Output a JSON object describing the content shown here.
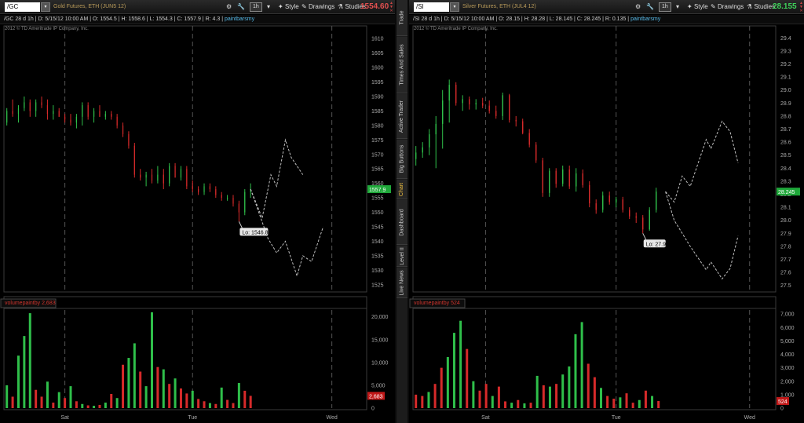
{
  "sidebar": {
    "tabs": [
      "Trade",
      "Times And Sales",
      "Active Trader",
      "Big Buttons",
      "Chart",
      "Dashboard",
      "Level II",
      "Live News"
    ],
    "active": "Chart"
  },
  "toolbar": {
    "aggregation_label": "1h",
    "style_label": "Style",
    "drawings_label": "Drawings",
    "studies_label": "Studies"
  },
  "colors": {
    "up": "#2fbf4a",
    "down": "#d62a2a",
    "grid": "#555555",
    "background": "#000000",
    "volume_study": "#d0342c",
    "study_label": "#56b8e6"
  },
  "left": {
    "symbol": "/GC",
    "description": "Gold Futures, ETH (JUN5 12)",
    "last_price": "1554.60",
    "last_price_color": "#e05050",
    "info_symbol": "/GC 28 d 1h",
    "info_date": "D: 5/15/12 10:00 AM",
    "info_open": "O: 1554.5",
    "info_high": "H: 1558.6",
    "info_low": "L: 1554.3",
    "info_close": "C: 1557.9",
    "info_range": "R: 4.3",
    "study_name": "paintbarsmy",
    "copyright": "2012 © TD Ameritrade IP Company, Inc.",
    "price_label": "1557.9",
    "low_label": "Lo: 1546.8",
    "volume_label": "volumepaintby",
    "volume_value": "2,683",
    "volume_marker": "2,683"
  },
  "right": {
    "symbol": "/SI",
    "description": "Silver Futures, ETH (JUL4 12)",
    "last_price": "28.155",
    "last_price_color": "#3fd05a",
    "info_symbol": "/SI 28 d 1h",
    "info_date": "D: 5/15/12 10:00 AM",
    "info_open": "O: 28.15",
    "info_high": "H: 28.28",
    "info_low": "L: 28.145",
    "info_close": "C: 28.245",
    "info_range": "R: 0.135",
    "study_name": "paintbarsmy",
    "copyright": "2012 © TD Ameritrade IP Company, Inc.",
    "price_label": "28.245",
    "low_label": "Lo: 27.9",
    "volume_label": "volumepaintby",
    "volume_value": "524",
    "volume_marker": "524"
  },
  "chart_data": [
    {
      "type": "candlestick",
      "title": "Gold Futures, ETH (JUN5 12)",
      "x_ticks": [
        "Sat",
        "Tue",
        "Wed"
      ],
      "y_ticks": [
        1525,
        1530,
        1535,
        1540,
        1545,
        1550,
        1555,
        1560,
        1565,
        1570,
        1575,
        1580,
        1585,
        1590,
        1595,
        1600,
        1605,
        1610
      ],
      "ylim": [
        1522.5,
        1612.5
      ],
      "xlim": [
        0,
        125
      ],
      "candles": [
        [
          1581,
          1586,
          1580,
          1585
        ],
        [
          1585,
          1589,
          1583,
          1584
        ],
        [
          1584,
          1587,
          1581,
          1586
        ],
        [
          1586,
          1590,
          1585,
          1588
        ],
        [
          1588,
          1589,
          1583,
          1585
        ],
        [
          1585,
          1589,
          1583,
          1588
        ],
        [
          1588,
          1590,
          1586,
          1587
        ],
        [
          1587,
          1589,
          1582,
          1584
        ],
        [
          1584,
          1587,
          1582,
          1585
        ],
        [
          1585,
          1586,
          1583,
          1583
        ],
        [
          1583,
          1584,
          1581,
          1582
        ],
        [
          1582,
          1584,
          1580,
          1581
        ],
        [
          1581,
          1584,
          1579,
          1583
        ],
        [
          1583,
          1588,
          1580,
          1587
        ],
        [
          1587,
          1588,
          1582,
          1583
        ],
        [
          1583,
          1586,
          1581,
          1585
        ],
        [
          1585,
          1587,
          1583,
          1583
        ],
        [
          1583,
          1585,
          1582,
          1584
        ],
        [
          1584,
          1585,
          1582,
          1583
        ],
        [
          1583,
          1584,
          1579,
          1580
        ],
        [
          1580,
          1581,
          1576,
          1577
        ],
        [
          1577,
          1578,
          1572,
          1573
        ],
        [
          1573,
          1574,
          1562,
          1563
        ],
        [
          1563,
          1565,
          1561,
          1562
        ],
        [
          1562,
          1564,
          1559,
          1563
        ],
        [
          1563,
          1565,
          1560,
          1561
        ],
        [
          1561,
          1566,
          1560,
          1563
        ],
        [
          1563,
          1565,
          1558,
          1560
        ],
        [
          1560,
          1567,
          1559,
          1566
        ],
        [
          1566,
          1567,
          1562,
          1562
        ],
        [
          1562,
          1566,
          1561,
          1565
        ],
        [
          1565,
          1566,
          1558,
          1559
        ],
        [
          1559,
          1561,
          1557,
          1558
        ],
        [
          1558,
          1559,
          1556,
          1557
        ],
        [
          1557,
          1560,
          1556,
          1559
        ],
        [
          1559,
          1560,
          1557,
          1558
        ],
        [
          1558,
          1559,
          1555,
          1556
        ],
        [
          1556,
          1557,
          1554,
          1555
        ],
        [
          1555,
          1556,
          1554,
          1555
        ],
        [
          1555,
          1556,
          1552,
          1553
        ],
        [
          1553,
          1554,
          1546.8,
          1550
        ],
        [
          1550,
          1558,
          1549,
          1557
        ],
        [
          1557,
          1560,
          1555,
          1558
        ]
      ],
      "projection_upper": [
        [
          1557,
          1558
        ],
        [
          1561,
          1548
        ],
        [
          1564,
          1563
        ],
        [
          1566,
          1559
        ],
        [
          1569,
          1575
        ],
        [
          1571,
          1569
        ],
        [
          1575,
          1563
        ]
      ],
      "projection_lower": [
        [
          1557,
          1558
        ],
        [
          1563,
          1541
        ],
        [
          1566,
          1536
        ],
        [
          1569,
          1540
        ],
        [
          1573,
          1528
        ],
        [
          1575,
          1535
        ],
        [
          1578,
          1533
        ],
        [
          1582,
          1545
        ]
      ],
      "volume": {
        "ylim": [
          0,
          21500
        ],
        "y_ticks": [
          0,
          5000,
          10000,
          15000,
          20000
        ],
        "y_tick_labels": [
          "0",
          "5,000",
          "10,000",
          "15,000",
          "20,000"
        ],
        "values": [
          5000,
          2500,
          11500,
          15800,
          20800,
          4000,
          2500,
          5800,
          1200,
          3500,
          2200,
          4800,
          1500,
          900,
          600,
          500,
          700,
          1200,
          3100,
          2200,
          9500,
          11000,
          14200,
          8000,
          4800,
          21000,
          9000,
          8500,
          5300,
          6500,
          4300,
          3200,
          3800,
          2000,
          1500,
          1100,
          900,
          4500,
          1800,
          1100,
          5500,
          3800,
          2683
        ]
      },
      "volume_colors": [
        "up",
        "down",
        "up",
        "up",
        "up",
        "down",
        "down",
        "up",
        "down",
        "up",
        "down",
        "up",
        "down",
        "up",
        "down",
        "up",
        "down",
        "up",
        "down",
        "up",
        "down",
        "up",
        "up",
        "down",
        "up",
        "up",
        "down",
        "up",
        "down",
        "up",
        "down",
        "down",
        "up",
        "down",
        "down",
        "up",
        "down",
        "up",
        "down",
        "down",
        "up",
        "down",
        "down"
      ]
    },
    {
      "type": "candlestick",
      "title": "Silver Futures, ETH (JUL4 12)",
      "x_ticks": [
        "Sat",
        "Tue",
        "Wed"
      ],
      "y_ticks": [
        27.5,
        27.6,
        27.7,
        27.8,
        27.9,
        28.0,
        28.1,
        28.2,
        28.3,
        28.4,
        28.5,
        28.6,
        28.7,
        28.8,
        28.9,
        29.0,
        29.1,
        29.2,
        29.3,
        29.4
      ],
      "ylim": [
        27.45,
        29.45
      ],
      "xlim": [
        0,
        125
      ],
      "candles": [
        [
          28.47,
          28.57,
          28.42,
          28.52
        ],
        [
          28.52,
          28.6,
          28.48,
          28.56
        ],
        [
          28.56,
          28.7,
          28.5,
          28.66
        ],
        [
          28.66,
          28.8,
          28.4,
          28.74
        ],
        [
          28.74,
          29.0,
          28.55,
          28.92
        ],
        [
          28.92,
          29.08,
          28.75,
          29.04
        ],
        [
          29.04,
          29.06,
          28.88,
          28.9
        ],
        [
          28.9,
          28.96,
          28.84,
          28.93
        ],
        [
          28.93,
          28.95,
          28.85,
          28.89
        ],
        [
          28.89,
          28.93,
          28.85,
          28.9
        ],
        [
          28.9,
          28.94,
          28.86,
          28.88
        ],
        [
          28.88,
          28.92,
          28.82,
          28.84
        ],
        [
          28.84,
          28.88,
          28.78,
          28.8
        ],
        [
          28.8,
          28.98,
          28.77,
          28.96
        ],
        [
          28.96,
          28.97,
          28.75,
          28.77
        ],
        [
          28.77,
          28.8,
          28.72,
          28.76
        ],
        [
          28.76,
          28.78,
          28.66,
          28.67
        ],
        [
          28.67,
          28.7,
          28.56,
          28.58
        ],
        [
          28.58,
          28.6,
          28.44,
          28.46
        ],
        [
          28.46,
          28.48,
          28.18,
          28.21
        ],
        [
          28.21,
          28.4,
          28.18,
          28.38
        ],
        [
          28.38,
          28.4,
          28.25,
          28.28
        ],
        [
          28.28,
          28.42,
          28.26,
          28.39
        ],
        [
          28.39,
          28.42,
          28.24,
          28.26
        ],
        [
          28.26,
          28.4,
          28.22,
          28.36
        ],
        [
          28.36,
          28.39,
          28.25,
          28.27
        ],
        [
          28.27,
          28.3,
          28.1,
          28.13
        ],
        [
          28.13,
          28.16,
          28.05,
          28.08
        ],
        [
          28.08,
          28.22,
          28.06,
          28.19
        ],
        [
          28.19,
          28.22,
          28.12,
          28.14
        ],
        [
          28.14,
          28.18,
          28.1,
          28.16
        ],
        [
          28.16,
          28.18,
          28.06,
          28.08
        ],
        [
          28.08,
          28.1,
          28.01,
          28.03
        ],
        [
          28.03,
          28.06,
          27.98,
          28.02
        ],
        [
          28.02,
          28.04,
          27.9,
          27.93
        ],
        [
          27.93,
          28.1,
          27.92,
          28.08
        ],
        [
          28.08,
          28.25,
          28.06,
          28.22
        ]
      ],
      "projection_upper": [
        [
          28.245,
          28.22
        ],
        [
          28.3,
          28.14
        ],
        [
          28.35,
          28.34
        ],
        [
          28.4,
          28.26
        ],
        [
          28.5,
          28.62
        ],
        [
          28.53,
          28.55
        ],
        [
          28.6,
          28.76
        ],
        [
          28.65,
          28.68
        ],
        [
          28.7,
          28.44
        ]
      ],
      "projection_lower": [
        [
          28.245,
          28.22
        ],
        [
          28.3,
          28.0
        ],
        [
          28.35,
          27.9
        ],
        [
          28.4,
          27.8
        ],
        [
          28.5,
          27.62
        ],
        [
          28.53,
          27.68
        ],
        [
          28.6,
          27.55
        ],
        [
          28.65,
          27.63
        ],
        [
          28.7,
          27.88
        ]
      ],
      "volume": {
        "ylim": [
          0,
          7300
        ],
        "y_ticks": [
          0,
          1000,
          2000,
          3000,
          4000,
          5000,
          6000,
          7000
        ],
        "y_tick_labels": [
          "0",
          "1,000",
          "2,000",
          "3,000",
          "4,000",
          "5,000",
          "6,000",
          "7,000"
        ],
        "values": [
          1000,
          900,
          1200,
          1800,
          3000,
          3800,
          5600,
          6500,
          4400,
          2000,
          1300,
          1800,
          900,
          1600,
          500,
          400,
          600,
          350,
          400,
          2400,
          1700,
          1600,
          1800,
          2500,
          3100,
          5500,
          6400,
          3300,
          2300,
          1500,
          900,
          700,
          800,
          1100,
          400,
          600,
          1300,
          900,
          524
        ]
      },
      "volume_colors": [
        "down",
        "down",
        "up",
        "down",
        "down",
        "up",
        "up",
        "up",
        "down",
        "up",
        "down",
        "down",
        "up",
        "down",
        "down",
        "up",
        "down",
        "up",
        "down",
        "up",
        "down",
        "up",
        "down",
        "up",
        "up",
        "up",
        "up",
        "down",
        "down",
        "up",
        "down",
        "down",
        "up",
        "down",
        "down",
        "up",
        "down",
        "up",
        "down"
      ]
    }
  ]
}
